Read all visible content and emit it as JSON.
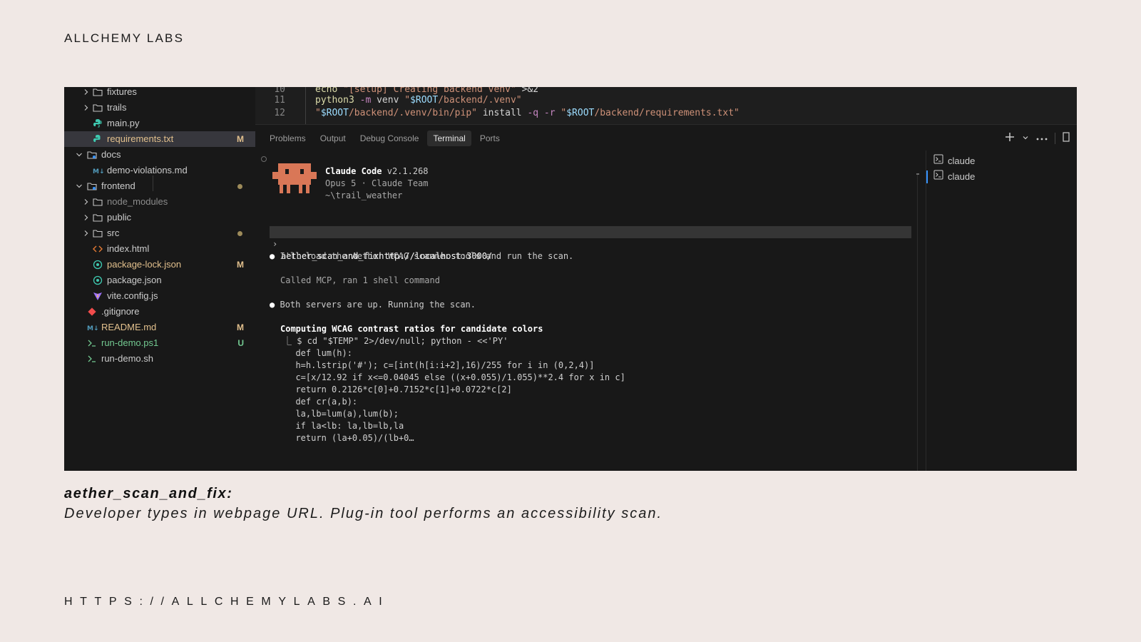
{
  "brand": "ALLCHEMY LABS",
  "explorer": {
    "items": [
      {
        "name": "fixtures",
        "kind": "folder"
      },
      {
        "name": "trails",
        "kind": "folder"
      },
      {
        "name": "main.py",
        "kind": "python"
      },
      {
        "name": "requirements.txt",
        "kind": "text",
        "badge": "M",
        "selected": true
      },
      {
        "name": "docs",
        "kind": "folder-open"
      },
      {
        "name": "demo-violations.md",
        "kind": "markdown"
      },
      {
        "name": "frontend",
        "kind": "folder-open",
        "dot": true
      },
      {
        "name": "node_modules",
        "kind": "folder"
      },
      {
        "name": "public",
        "kind": "folder"
      },
      {
        "name": "src",
        "kind": "folder",
        "dot": true
      },
      {
        "name": "index.html",
        "kind": "html"
      },
      {
        "name": "package-lock.json",
        "kind": "json",
        "badge": "M"
      },
      {
        "name": "package.json",
        "kind": "json"
      },
      {
        "name": "vite.config.js",
        "kind": "vite"
      },
      {
        "name": ".gitignore",
        "kind": "git"
      },
      {
        "name": "README.md",
        "kind": "markdown",
        "badge": "M"
      },
      {
        "name": "run-demo.ps1",
        "kind": "shell",
        "badge": "U"
      },
      {
        "name": "run-demo.sh",
        "kind": "shell"
      }
    ]
  },
  "editor": {
    "lines": [
      {
        "num": "10",
        "parts": [
          [
            "kw",
            "echo "
          ],
          [
            "str",
            "\"[setup] Creating backend venv\" "
          ],
          [
            "plain",
            ">&2"
          ]
        ]
      },
      {
        "num": "11",
        "parts": [
          [
            "kw",
            "python3 "
          ],
          [
            "flag",
            "-m "
          ],
          [
            "plain",
            "venv "
          ],
          [
            "str",
            "\""
          ],
          [
            "var",
            "$ROOT"
          ],
          [
            "str",
            "/backend/.venv\""
          ]
        ]
      },
      {
        "num": "12",
        "parts": [
          [
            "str",
            "\""
          ],
          [
            "var",
            "$ROOT"
          ],
          [
            "str",
            "/backend/.venv/bin/pip\" "
          ],
          [
            "plain",
            "install "
          ],
          [
            "flag",
            "-q -r "
          ],
          [
            "str",
            "\""
          ],
          [
            "var",
            "$ROOT"
          ],
          [
            "str",
            "/backend/requirements.txt\""
          ]
        ]
      }
    ]
  },
  "panel": {
    "tabs": [
      "Problems",
      "Output",
      "Debug Console",
      "Terminal",
      "Ports"
    ],
    "active_tab": "Terminal"
  },
  "terminal": {
    "app_name": "Claude Code",
    "version": "v2.1.268",
    "model_line": "Opus 5 · Claude Team",
    "cwd": "~\\trail_weather",
    "prompt_text": "aether_scan_and_fixhttp://localhost:3000/",
    "msg1": "I'll load the Aether WCAG scanner tools and run the scan.",
    "msg1_detail": "Called MCP, ran 1 shell command",
    "msg2": "Both servers are up. Running the scan.",
    "task_title": "Computing WCAG contrast ratios for candidate colors",
    "code_lines": [
      "⎿ $ cd \"$TEMP\" 2>/dev/null; python - <<'PY'",
      "  def lum(h):",
      "  h=h.lstrip('#'); c=[int(h[i:i+2],16)/255 for i in (0,2,4)]",
      "  c=[x/12.92 if x<=0.04045 else ((x+0.055)/1.055)**2.4 for x in c]",
      "  return 0.2126*c[0]+0.7152*c[1]+0.0722*c[2]",
      "  def cr(a,b):",
      "  la,lb=lum(a),lum(b);",
      "  if la<lb: la,lb=lb,la",
      "  return (la+0.05)/(lb+0…"
    ]
  },
  "terminal_list": [
    "claude",
    "claude"
  ],
  "caption": {
    "title": "aether_scan_and_fix:",
    "body": "Developer types in webpage URL. Plug-in tool performs an accessibility scan."
  },
  "url": "HTTPS://ALLCHEMYLABS.AI",
  "colors": {
    "modified": "#e2c08d",
    "untracked": "#73c991",
    "accent": "#3794ff",
    "mascot": "#d97757"
  }
}
